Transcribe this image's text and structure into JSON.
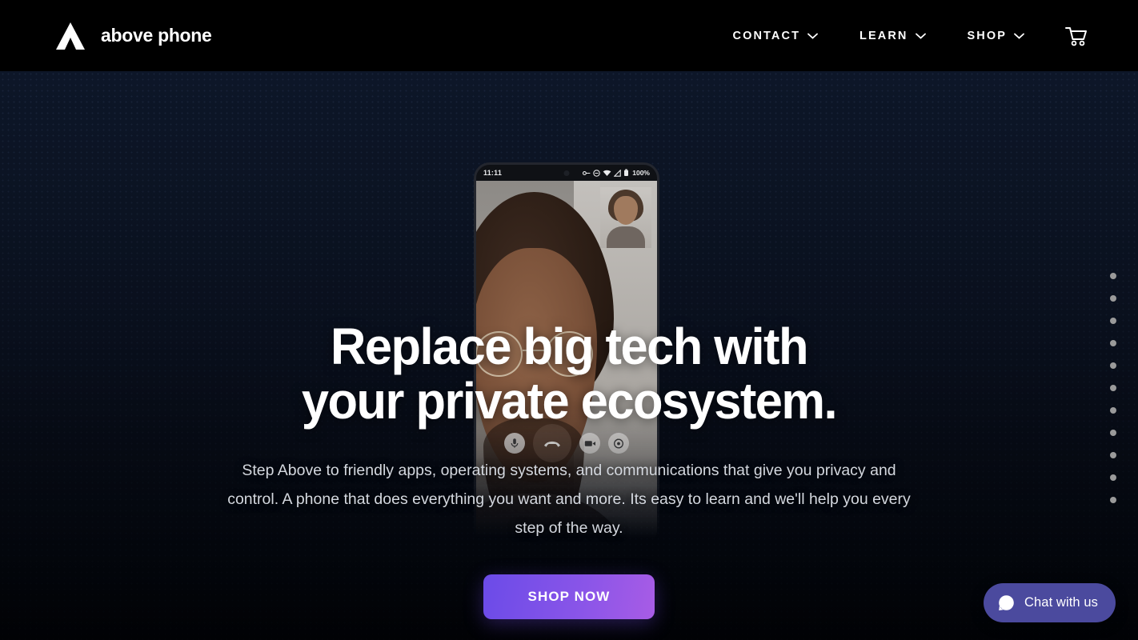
{
  "header": {
    "brand_name": "above phone",
    "logo_icon": "above-phone-triangle-logo",
    "nav": [
      {
        "label": "CONTACT",
        "icon": "chevron-down-icon"
      },
      {
        "label": "LEARN",
        "icon": "chevron-down-icon"
      },
      {
        "label": "SHOP",
        "icon": "chevron-down-icon"
      }
    ],
    "cart_icon": "shopping-cart-icon"
  },
  "hero": {
    "headline_line1": "Replace big tech with",
    "headline_line2": "your private ecosystem.",
    "subcopy": "Step Above to friendly apps, operating systems, and communications that give you privacy and control. A phone that does everything you want and more. Its easy to learn and we'll help you every step of the way.",
    "cta_label": "SHOP NOW",
    "cta_gradient_from": "#6B4BE8",
    "cta_gradient_to": "#A85CE6",
    "background_color": "#0b1322"
  },
  "phone": {
    "status_time": "11:11",
    "battery_percent": "100%",
    "status_icons": [
      "vpn-key-icon",
      "do-not-disturb-icon",
      "wifi-icon",
      "cellular-signal-icon",
      "battery-icon"
    ],
    "call_controls": [
      {
        "name": "microphone-button",
        "icon": "microphone-icon"
      },
      {
        "name": "end-call-button",
        "icon": "phone-hangup-icon"
      },
      {
        "name": "video-toggle-button",
        "icon": "video-camera-icon"
      },
      {
        "name": "switch-camera-button",
        "icon": "camera-flip-icon"
      }
    ]
  },
  "section_dots": {
    "count": 11,
    "color": "#9a9a9a"
  },
  "chat": {
    "label": "Chat with us",
    "icon": "chat-bubble-icon",
    "background_color": "#4B4A9E"
  }
}
